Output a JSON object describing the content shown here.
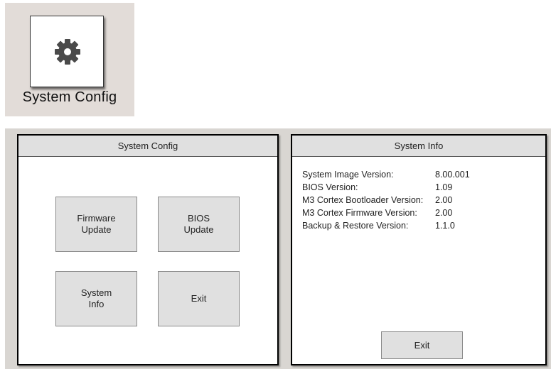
{
  "app_icon": {
    "label": "System Config",
    "icon": "gear-icon"
  },
  "system_config_panel": {
    "title": "System Config",
    "buttons": [
      {
        "line1": "Firmware",
        "line2": "Update"
      },
      {
        "line1": "BIOS",
        "line2": "Update"
      },
      {
        "line1": "System",
        "line2": "Info"
      },
      {
        "line1": "Exit",
        "line2": ""
      }
    ]
  },
  "system_info_panel": {
    "title": "System Info",
    "rows": [
      {
        "label": "System Image Version:",
        "value": "8.00.001"
      },
      {
        "label": "BIOS Version:",
        "value": "1.09"
      },
      {
        "label": "M3 Cortex Bootloader Version:",
        "value": "2.00"
      },
      {
        "label": "M3 Cortex Firmware Version:",
        "value": "2.00"
      },
      {
        "label": "Backup & Restore Version:",
        "value": "1.1.0"
      }
    ],
    "exit_label": "Exit"
  },
  "colors": {
    "tile_background": "#e2dcd8",
    "button_face": "#e0e0e0",
    "gear": "#4a4a4a"
  }
}
